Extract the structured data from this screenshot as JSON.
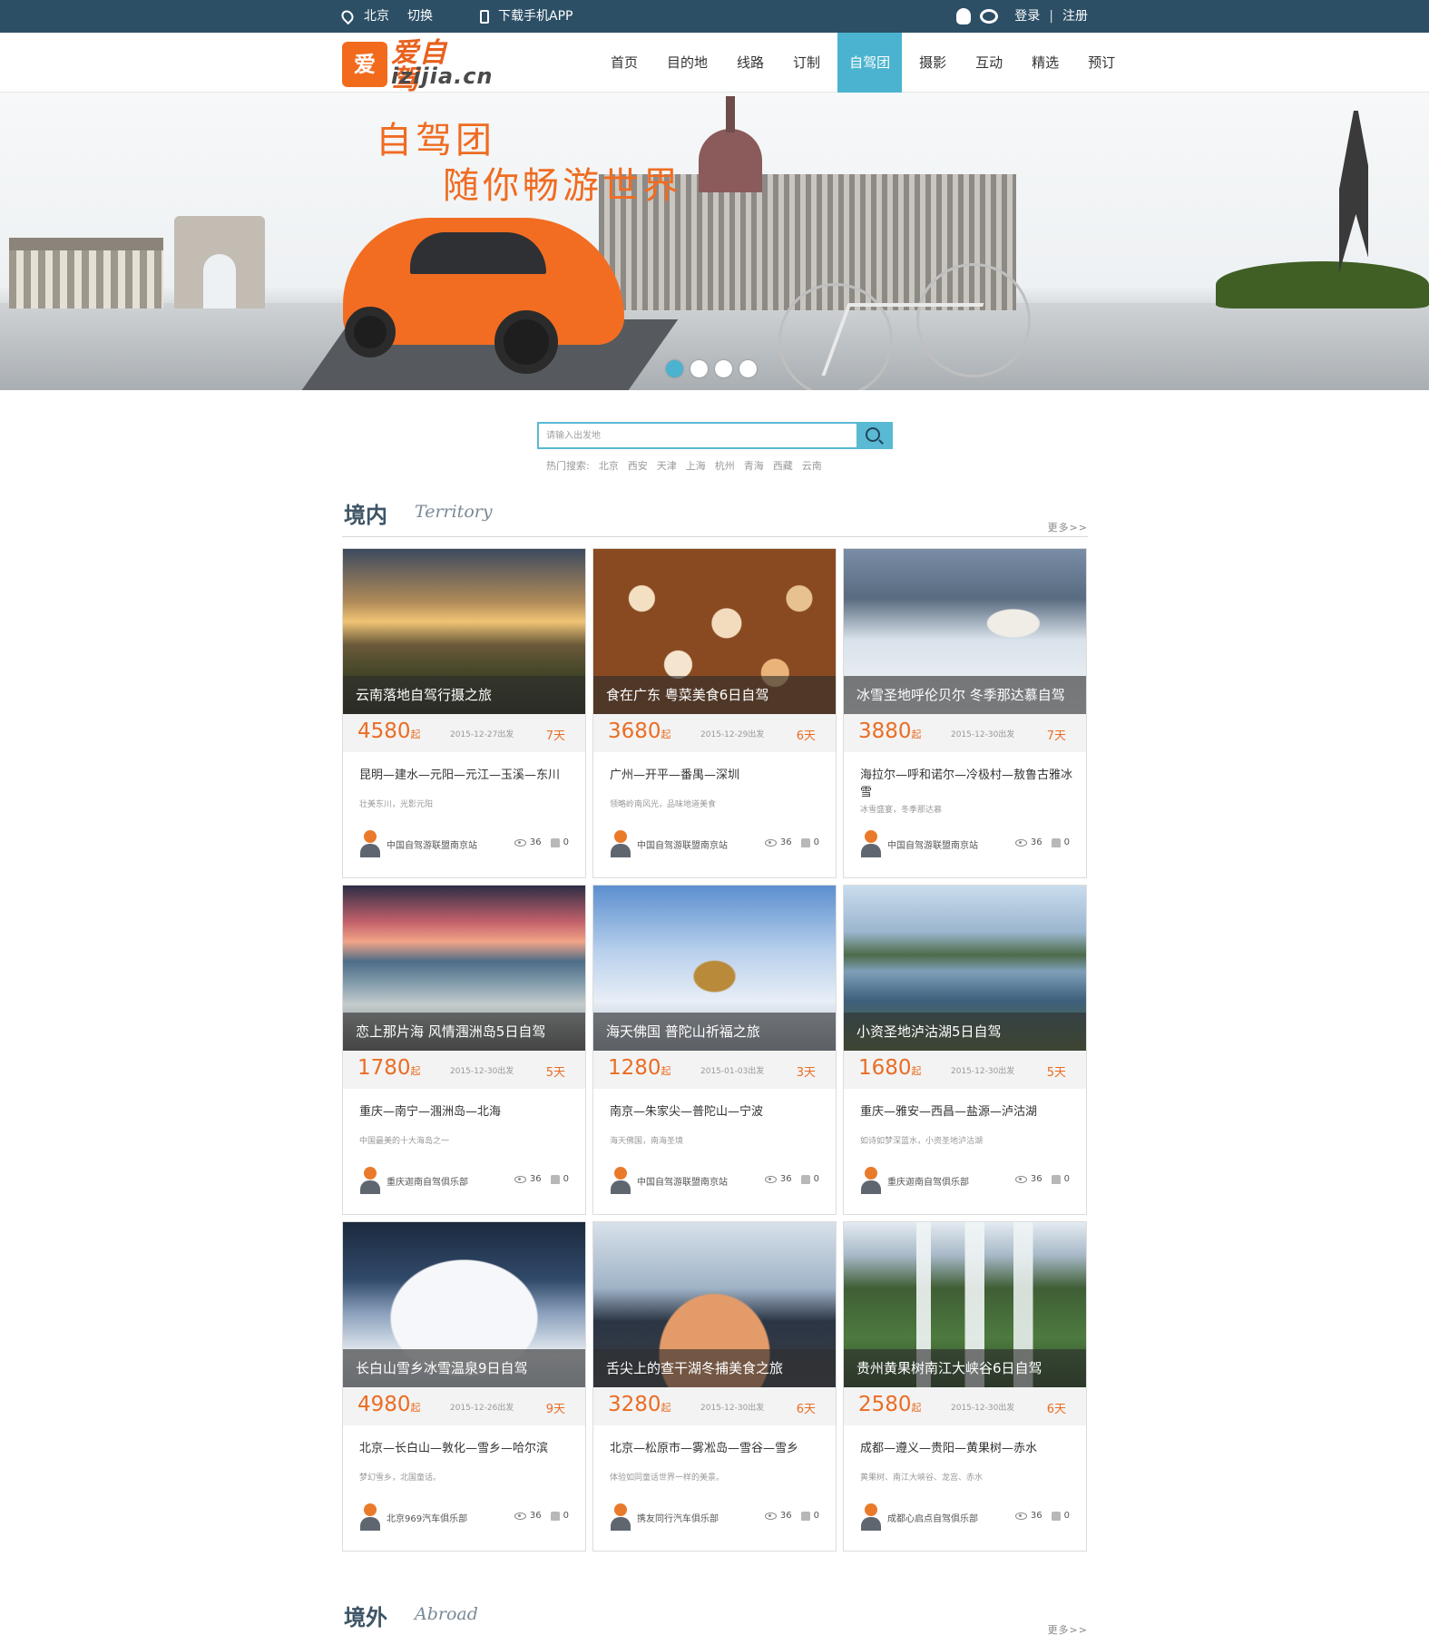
{
  "topbar": {
    "location": "北京",
    "switch_city": "切换",
    "download_app": "下载手机APP",
    "login": "登录",
    "separator": "|",
    "register": "注册"
  },
  "logo": {
    "mark": "爱",
    "cn": "爱自驾",
    "en": "izijia.cn"
  },
  "nav": [
    {
      "label": "首页"
    },
    {
      "label": "目的地"
    },
    {
      "label": "线路"
    },
    {
      "label": "订制"
    },
    {
      "label": "自驾团",
      "active": true
    },
    {
      "label": "摄影"
    },
    {
      "label": "互动"
    },
    {
      "label": "精选"
    },
    {
      "label": "预订"
    }
  ],
  "banner": {
    "line1": "自驾团",
    "line2": "随你畅游世界",
    "slide_count": 4,
    "active_slide": 1
  },
  "search": {
    "placeholder": "请输入出发地",
    "hot_label": "热门搜索:",
    "hot": [
      "北京",
      "西安",
      "天津",
      "上海",
      "杭州",
      "青海",
      "西藏",
      "云南"
    ]
  },
  "sections": {
    "domestic": {
      "cn": "境内",
      "en": "Territory",
      "more": "更多>>"
    },
    "abroad": {
      "cn": "境外",
      "en": "Abroad",
      "more": "更多>>"
    }
  },
  "cards": [
    {
      "title": "云南落地自驾行摄之旅",
      "price": "4580",
      "price_suffix": "起",
      "date": "2015-12-27出发",
      "days": "7天",
      "route": "昆明—建水—元阳—元江—玉溪—东川",
      "desc": "壮美东川，光影元阳",
      "author": "中国自驾游联盟南京站",
      "views": "36",
      "likes": "0",
      "photo": "ph-sunset"
    },
    {
      "title": "食在广东 粤菜美食6日自驾",
      "price": "3680",
      "price_suffix": "起",
      "date": "2015-12-29出发",
      "days": "6天",
      "route": "广州—开平—番禺—深圳",
      "desc": "领略岭南风光，品味地道美食",
      "author": "中国自驾游联盟南京站",
      "views": "36",
      "likes": "0",
      "photo": "ph-food"
    },
    {
      "title": "冰雪圣地呼伦贝尔 冬季那达慕自驾",
      "price": "3880",
      "price_suffix": "起",
      "date": "2015-12-30出发",
      "days": "7天",
      "route": "海拉尔—呼和诺尔—冷极村—敖鲁古雅冰雪",
      "desc": "冰雪盛宴，冬季那达慕",
      "author": "中国自驾游联盟南京站",
      "views": "36",
      "likes": "0",
      "photo": "ph-snowhorse"
    },
    {
      "title": "恋上那片海 风情涠洲岛5日自驾",
      "price": "1780",
      "price_suffix": "起",
      "date": "2015-12-30出发",
      "days": "5天",
      "route": "重庆—南宁—涠洲岛—北海",
      "desc": "中国最美的十大海岛之一",
      "author": "重庆迦南自驾俱乐部",
      "views": "36",
      "likes": "0",
      "photo": "ph-beach"
    },
    {
      "title": "海天佛国 普陀山祈福之旅",
      "price": "1280",
      "price_suffix": "起",
      "date": "2015-01-03出发",
      "days": "3天",
      "route": "南京—朱家尖—普陀山—宁波",
      "desc": "海天佛国，南海圣境",
      "author": "中国自驾游联盟南京站",
      "views": "36",
      "likes": "0",
      "photo": "ph-buddha"
    },
    {
      "title": "小资圣地泸沽湖5日自驾",
      "price": "1680",
      "price_suffix": "起",
      "date": "2015-12-30出发",
      "days": "5天",
      "route": "重庆—雅安—西昌—盐源—泸沽湖",
      "desc": "如诗如梦深蓝水，小资圣地泸沽湖",
      "author": "重庆迦南自驾俱乐部",
      "views": "36",
      "likes": "0",
      "photo": "ph-lake"
    },
    {
      "title": "长白山雪乡冰雪温泉9日自驾",
      "price": "4980",
      "price_suffix": "起",
      "date": "2015-12-26出发",
      "days": "9天",
      "route": "北京—长白山—敦化—雪乡—哈尔滨",
      "desc": "梦幻雪乡，北国童话。",
      "author": "北京969汽车俱乐部",
      "views": "36",
      "likes": "0",
      "photo": "ph-snowhouse"
    },
    {
      "title": "舌尖上的查干湖冬捕美食之旅",
      "price": "3280",
      "price_suffix": "起",
      "date": "2015-12-30出发",
      "days": "6天",
      "route": "北京—松原市—雾凇岛—雪谷—雪乡",
      "desc": "体验如同童话世界一样的美景。",
      "author": "携友同行汽车俱乐部",
      "views": "36",
      "likes": "0",
      "photo": "ph-fishing"
    },
    {
      "title": "贵州黄果树南江大峡谷6日自驾",
      "price": "2580",
      "price_suffix": "起",
      "date": "2015-12-30出发",
      "days": "6天",
      "route": "成都—遵义—贵阳—黄果树—赤水",
      "desc": "黄果树、南江大峡谷、龙宫、赤水",
      "author": "成都心启点自驾俱乐部",
      "views": "36",
      "likes": "0",
      "photo": "ph-waterfall"
    }
  ]
}
